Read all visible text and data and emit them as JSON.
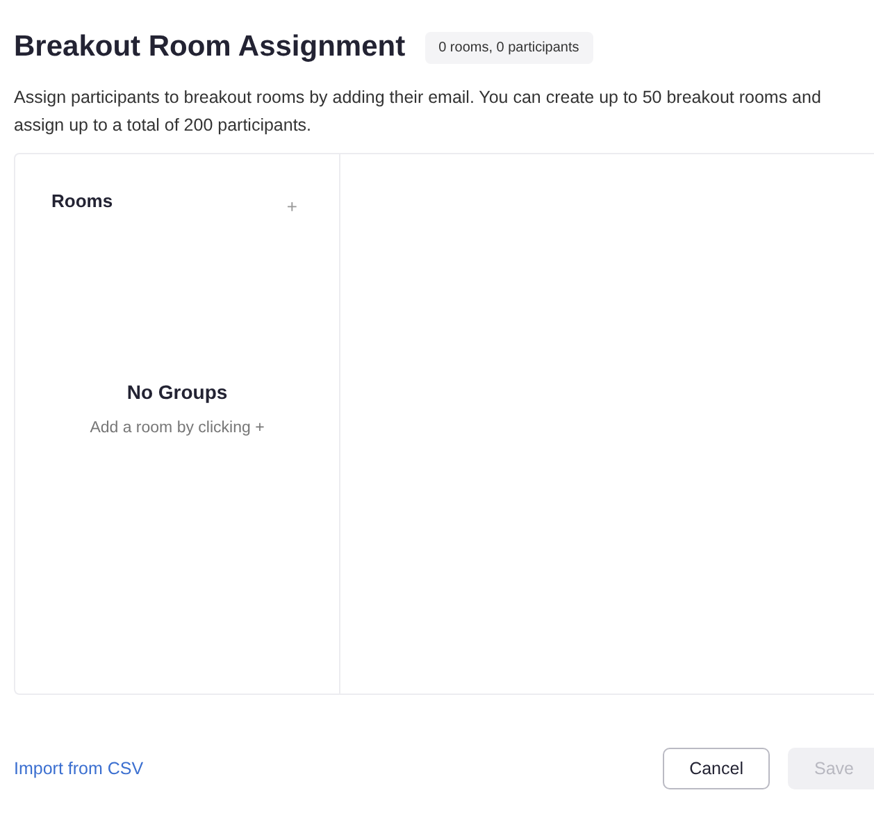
{
  "header": {
    "title": "Breakout Room Assignment",
    "badge": "0 rooms, 0 participants"
  },
  "description": "Assign participants to breakout rooms by adding their email. You can create up to 50 breakout rooms and assign up to a total of 200 participants.",
  "rooms_panel": {
    "title": "Rooms",
    "add_button": "+",
    "empty_title": "No Groups",
    "empty_hint": "Add a room by clicking +"
  },
  "footer": {
    "import_link": "Import from CSV",
    "buttons": [
      {
        "label": "Cancel",
        "disabled": false
      },
      {
        "label": "Save",
        "disabled": true
      }
    ]
  }
}
